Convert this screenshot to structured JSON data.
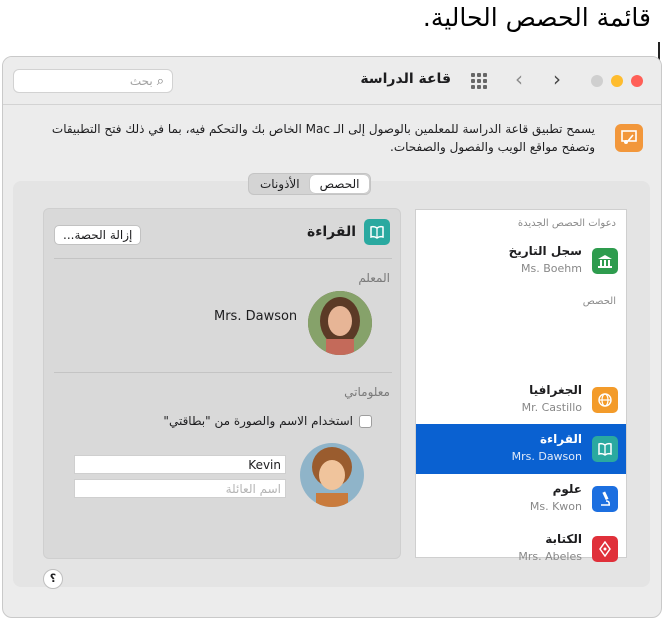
{
  "callout": {
    "text": "قائمة الحصص الحالية."
  },
  "window": {
    "title": "قاعة الدراسة"
  },
  "search": {
    "placeholder": "بحث"
  },
  "description": {
    "text": "يسمح تطبيق قاعة الدراسة للمعلمين بالوصول إلى الـ Mac الخاص بك والتحكم فيه، بما في ذلك فتح التطبيقات وتصفح مواقع الويب والفصول والصفحات."
  },
  "tabs": [
    {
      "label": "الحصص",
      "active": true
    },
    {
      "label": "الأذونات",
      "active": false
    }
  ],
  "detail": {
    "class_title": "القراءة",
    "remove_button": "إزالة الحصة...",
    "teacher_section": "المعلم",
    "teacher_name": "Mrs. Dawson",
    "my_info_section": "معلوماتي",
    "use_card_checkbox_label": "استخدام الاسم والصورة من \"بطاقتي\"",
    "first_name_value": "Kevin",
    "last_name_placeholder": "اسم العائلة"
  },
  "class_list": {
    "invitations_header": "دعوات الحصص الجديدة",
    "classes_header": "الحصص",
    "invitations": [
      {
        "title": "سجل التاريخ",
        "teacher": "Ms. Boehm",
        "icon": "museum-icon",
        "color": "#2e9c4e"
      }
    ],
    "classes": [
      {
        "title": "الجغرافيا",
        "teacher": "Mr. Castillo",
        "icon": "globe-icon",
        "color": "#f39b2a",
        "selected": false
      },
      {
        "title": "القراءة",
        "teacher": "Mrs. Dawson",
        "icon": "book-icon",
        "color": "#2aa9a0",
        "selected": true
      },
      {
        "title": "علوم",
        "teacher": "Ms. Kwon",
        "icon": "microscope-icon",
        "color": "#1c6fe0",
        "selected": false
      },
      {
        "title": "الكتابة",
        "teacher": "Mrs. Abeles",
        "icon": "pen-icon",
        "color": "#e0303a",
        "selected": false
      }
    ]
  },
  "colors": {
    "selection": "#0a61d1",
    "close": "#ff5f57",
    "minimize": "#febc2e",
    "zoom": "#cfcfcf"
  },
  "help": {
    "label": "؟"
  }
}
